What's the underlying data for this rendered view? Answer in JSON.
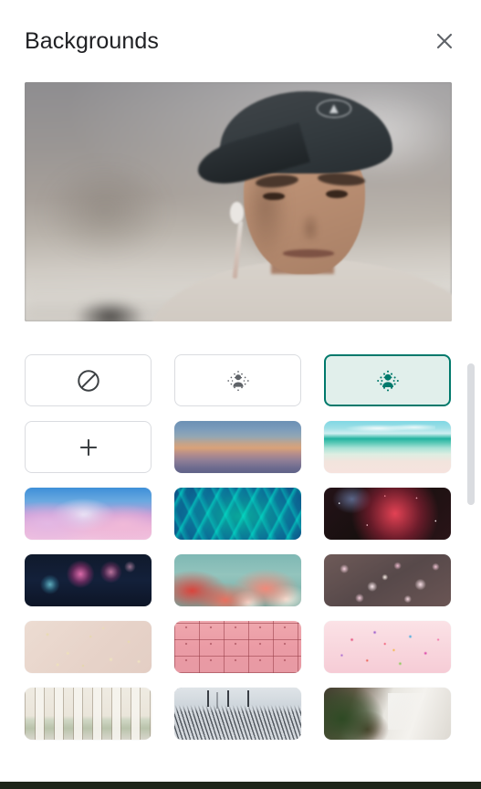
{
  "header": {
    "title": "Backgrounds",
    "close_label": "Close",
    "close_icon": "close-icon"
  },
  "preview": {
    "label": "Self view camera preview",
    "description": "Person wearing a dark baseball cap in a bright room"
  },
  "effects": [
    {
      "id": "no-effect",
      "label": "No effect",
      "icon": "no-effect-slash-circle-icon",
      "selected": false
    },
    {
      "id": "slight-blur",
      "label": "Slightly blur your background",
      "icon": "slight-blur-person-icon",
      "selected": false
    },
    {
      "id": "blur",
      "label": "Blur your background",
      "icon": "blur-person-icon",
      "selected": true
    }
  ],
  "upload": {
    "id": "upload-background",
    "label": "Upload a background image",
    "icon": "plus-icon"
  },
  "backgrounds": [
    {
      "id": "sunset-gradient",
      "label": "Dusk sky gradient",
      "art": "bg-sunset"
    },
    {
      "id": "beach",
      "label": "Tropical beach",
      "art": "bg-beach"
    },
    {
      "id": "pink-clouds",
      "label": "Pink clouds",
      "art": "bg-clouds"
    },
    {
      "id": "turquoise-water",
      "label": "Turquoise water ripples",
      "art": "bg-water"
    },
    {
      "id": "red-nebula",
      "label": "Red nebula in space",
      "art": "bg-space"
    },
    {
      "id": "fireworks",
      "label": "Fireworks at night",
      "art": "bg-fireworks"
    },
    {
      "id": "flowers-sky",
      "label": "Red and white flowers against teal sky",
      "art": "bg-flowers-sky"
    },
    {
      "id": "blossom-wall",
      "label": "Pink blossom wall",
      "art": "bg-blossom"
    },
    {
      "id": "beige-confetti",
      "label": "Beige confetti dots",
      "art": "bg-confetti-beige"
    },
    {
      "id": "pink-pattern",
      "label": "Pink tiled pattern",
      "art": "bg-pink-grid"
    },
    {
      "id": "pink-confetti",
      "label": "Pink confetti",
      "art": "bg-confetti-pink"
    },
    {
      "id": "gallery-cafe",
      "label": "Art gallery cafe interior",
      "art": "bg-gallery"
    },
    {
      "id": "modern-interior",
      "label": "Modern interior with pendant lights",
      "art": "bg-interior"
    },
    {
      "id": "bright-room-plants",
      "label": "Bright room with plants",
      "art": "bg-plants"
    }
  ],
  "colors": {
    "accent": "#00796B",
    "accent_fill": "#E1EFEB",
    "border": "#DADCE0",
    "text": "#202124",
    "icon": "#5F6368",
    "scrollbar": "#DADCE0",
    "bottom_bar": "#1E2519"
  }
}
